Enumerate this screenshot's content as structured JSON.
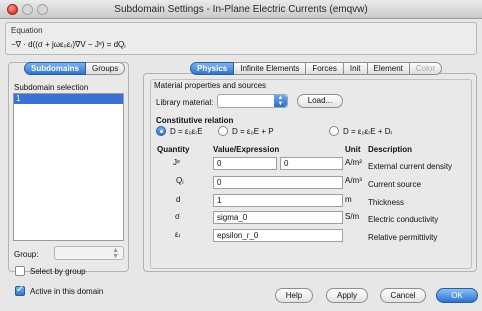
{
  "window": {
    "title": "Subdomain Settings - In-Plane Electric Currents (emqvw)"
  },
  "equation": {
    "label": "Equation",
    "text": "−∇ · d((σ + jωε₀εᵣ)∇V − Jᵉ) = dQⱼ"
  },
  "left_tabs": [
    "Subdomains",
    "Groups"
  ],
  "subdomain_selection": {
    "label": "Subdomain selection",
    "items": [
      "1"
    ]
  },
  "group": {
    "label": "Group:",
    "value": ""
  },
  "checkboxes": {
    "select_by_group": {
      "label": "Select by group",
      "checked": false
    },
    "active_in_domain": {
      "label": "Active in this domain",
      "checked": true
    }
  },
  "right_tabs": [
    "Physics",
    "Infinite Elements",
    "Forces",
    "Init",
    "Element",
    "Color"
  ],
  "material": {
    "section_label": "Material properties and sources",
    "library_label": "Library material:",
    "library_value": "",
    "load_label": "Load..."
  },
  "constitutive": {
    "label": "Constitutive relation",
    "options": [
      "D = ε₀εᵣE",
      "D = ε₀E + P",
      "D = ε₀εᵣE + Dᵣ"
    ],
    "selected": 0
  },
  "table": {
    "headers": {
      "quantity": "Quantity",
      "value": "Value/Expression",
      "unit": "Unit",
      "description": "Description"
    },
    "rows": [
      {
        "quantity": "Jᵉ",
        "value": "0",
        "value2": "0",
        "unit": "A/m²",
        "description": "External current density"
      },
      {
        "quantity": "Qⱼ",
        "value": "0",
        "unit": "A/m³",
        "description": "Current source"
      },
      {
        "quantity": "d",
        "value": "1",
        "unit": "m",
        "description": "Thickness"
      },
      {
        "quantity": "σ",
        "value": "sigma_0",
        "unit": "S/m",
        "description": "Electric conductivity"
      },
      {
        "quantity": "εᵣ",
        "value": "epsilon_r_0",
        "unit": "",
        "description": "Relative permittivity"
      }
    ]
  },
  "buttons": {
    "help": "Help",
    "apply": "Apply",
    "cancel": "Cancel",
    "ok": "OK"
  }
}
